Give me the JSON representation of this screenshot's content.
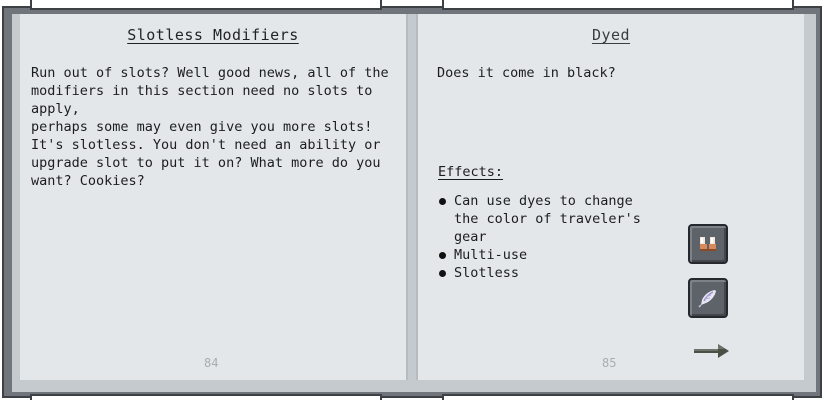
{
  "left_page": {
    "title": "Slotless Modifiers",
    "paragraph1": "Run out of slots? Well good news, all of the\nmodifiers in this section need no slots to apply,\nperhaps some may even give you more slots!",
    "paragraph2": "It's slotless. You don't need an ability or\nupgrade slot to put it on? What more do you\nwant? Cookies?",
    "page_number": "84"
  },
  "right_page": {
    "title": "Dyed",
    "intro": "Does it come in black?",
    "effects_title": "Effects:",
    "effects": [
      "Can use dyes to change the color of traveler's gear",
      "Multi-use",
      "Slotless"
    ],
    "page_number": "85",
    "items": [
      {
        "icon": "boots-icon"
      },
      {
        "icon": "feather-icon"
      }
    ],
    "next_icon": "arrow-right-icon"
  },
  "colors": {
    "frame": "#6f757b",
    "page": "#e4e7ea",
    "text": "#1b1d20",
    "page_number": "#a7adb2"
  }
}
